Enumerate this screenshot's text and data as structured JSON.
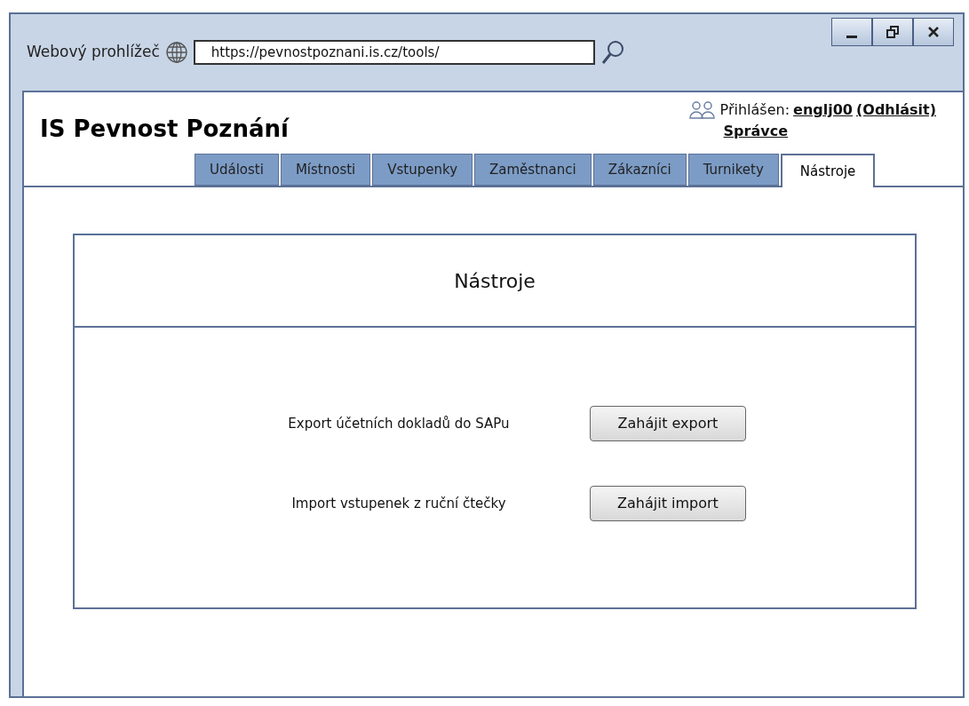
{
  "browser": {
    "title": "Webový prohlížeč",
    "url": "https://pevnostpoznani.is.cz/tools/"
  },
  "app": {
    "title": "IS Pevnost Poznání",
    "login_label": "Přihlášen:",
    "user": "englj00",
    "logout": "(Odhlásit)",
    "role": "Správce"
  },
  "tabs": [
    {
      "label": "Události",
      "selected": false
    },
    {
      "label": "Místnosti",
      "selected": false
    },
    {
      "label": "Vstupenky",
      "selected": false
    },
    {
      "label": "Zaměstnanci",
      "selected": false
    },
    {
      "label": "Zákazníci",
      "selected": false
    },
    {
      "label": "Turnikety",
      "selected": false
    },
    {
      "label": "Nástroje",
      "selected": true
    }
  ],
  "panel": {
    "title": "Nástroje",
    "rows": [
      {
        "label": "Export účetních dokladů do SAPu",
        "button": "Zahájit export"
      },
      {
        "label": "Import vstupenek z ruční čtečky",
        "button": "Zahájit import"
      }
    ]
  }
}
